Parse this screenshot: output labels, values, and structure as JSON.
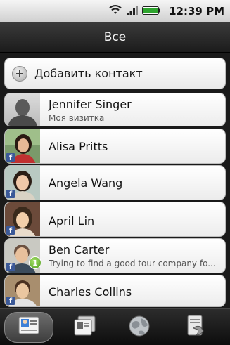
{
  "status_bar": {
    "time": "12:39 PM",
    "icons": [
      "wifi-icon",
      "signal-icon",
      "battery-icon"
    ]
  },
  "header": {
    "title": "Все"
  },
  "add_contact": {
    "label": "Добавить контакт",
    "icon": "plus-circle-icon"
  },
  "contacts": [
    {
      "name": "Jennifer Singer",
      "subtitle": "Моя визитка",
      "facebook": false,
      "updates": ""
    },
    {
      "name": "Alisa Pritts",
      "subtitle": "",
      "facebook": true,
      "updates": ""
    },
    {
      "name": "Angela Wang",
      "subtitle": "",
      "facebook": true,
      "updates": ""
    },
    {
      "name": "April  Lin",
      "subtitle": "",
      "facebook": true,
      "updates": ""
    },
    {
      "name": "Ben  Carter",
      "subtitle": "Trying to find a good tour company fo...",
      "facebook": true,
      "updates": "1"
    },
    {
      "name": "Charles  Collins",
      "subtitle": "",
      "facebook": true,
      "updates": ""
    }
  ],
  "tabs": [
    {
      "icon": "people-icon",
      "active": true
    },
    {
      "icon": "groups-icon",
      "active": false
    },
    {
      "icon": "online-directory-icon",
      "active": false
    },
    {
      "icon": "call-history-icon",
      "active": false
    }
  ],
  "colors": {
    "facebook": "#3b5998",
    "update_badge": "#5fb526",
    "header_bg": "#2a2a2a"
  }
}
